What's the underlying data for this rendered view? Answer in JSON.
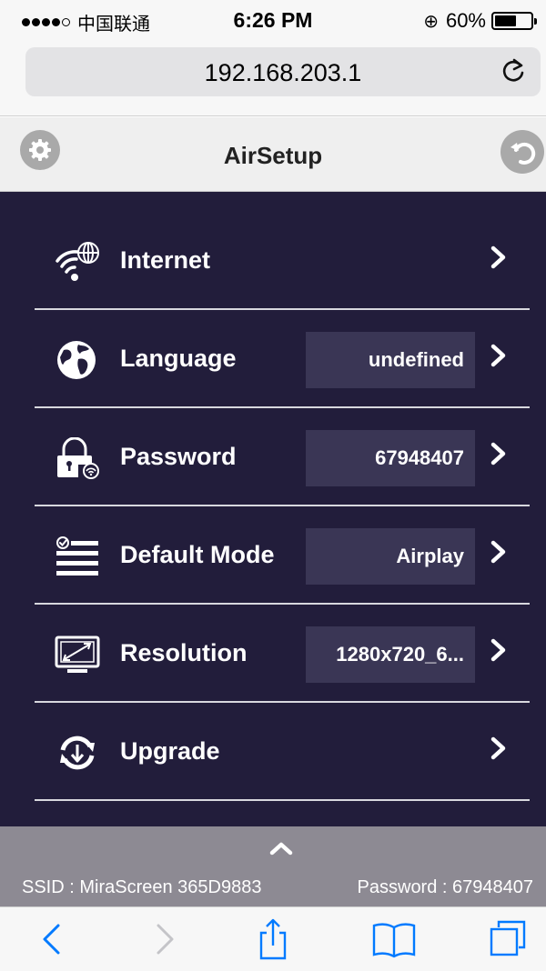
{
  "status_bar": {
    "carrier": "中国联通",
    "time": "6:26 PM",
    "rotation_lock_icon": "⊕",
    "battery_percent": "60%",
    "battery_level": 0.6
  },
  "browser": {
    "url": "192.168.203.1",
    "reload_icon": "reload-icon"
  },
  "header": {
    "title": "AirSetup",
    "settings_icon": "gear-icon",
    "back_icon": "back-icon"
  },
  "menu": {
    "items": [
      {
        "label": "Internet",
        "icon": "wifi-globe-icon",
        "value": ""
      },
      {
        "label": "Language",
        "icon": "globe-icon",
        "value": "undefined"
      },
      {
        "label": "Password",
        "icon": "lock-icon",
        "value": "67948407"
      },
      {
        "label": "Default Mode",
        "icon": "list-mode-icon",
        "value": "Airplay"
      },
      {
        "label": "Resolution",
        "icon": "monitor-icon",
        "value": "1280x720_6..."
      },
      {
        "label": "Upgrade",
        "icon": "upgrade-icon",
        "value": ""
      }
    ]
  },
  "info_bar": {
    "ssid": "SSID : MiraScreen 365D9883",
    "password": "Password : 67948407"
  },
  "colors": {
    "panel_bg": "#221d3b",
    "value_box_bg": "#3a3655",
    "info_bar_bg": "#8d8a93",
    "ios_blue": "#007aff"
  }
}
